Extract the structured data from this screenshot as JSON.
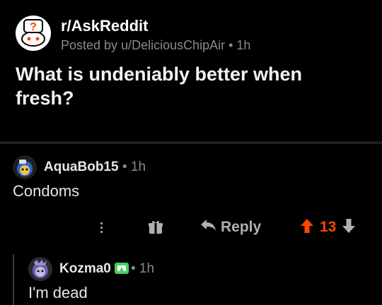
{
  "post": {
    "subreddit": "r/AskReddit",
    "meta": "Posted by u/DeliciousChipAir • 1h",
    "title": "What is undeniably better when fresh?",
    "subreddit_icon": "askreddit-snoo-icon"
  },
  "comment": {
    "author": "AquaBob15",
    "meta": "• 1h",
    "body": "Condoms",
    "avatar_icon": "blue-snoo-avatar-icon"
  },
  "actions": {
    "more_icon": "vertical-dots-icon",
    "award_icon": "gift-award-icon",
    "reply_icon": "reply-arrow-icon",
    "reply_label": "Reply",
    "score": "13",
    "upvote_icon": "upvote-arrow-icon",
    "downvote_icon": "downvote-arrow-icon"
  },
  "reply": {
    "author": "Kozma0",
    "meta": "• 1h",
    "body": "I'm dead",
    "avatar_icon": "purple-snoo-avatar-icon",
    "badge_icon": "moderator-shield-icon"
  },
  "colors": {
    "background": "#000000",
    "accent_upvote": "#ff4500",
    "muted_text": "#8a8a8a",
    "primary_text": "#e6e6e6",
    "mod_badge": "#46d160"
  }
}
